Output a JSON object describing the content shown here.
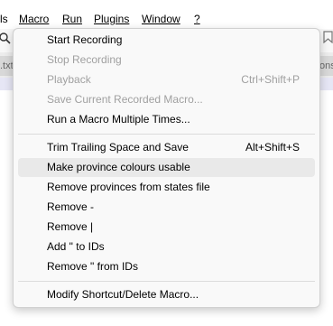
{
  "menubar": {
    "items": [
      {
        "label": "ls"
      },
      {
        "label": "Macro"
      },
      {
        "label": "Run"
      },
      {
        "label": "Plugins"
      },
      {
        "label": "Window"
      },
      {
        "label": "?"
      }
    ]
  },
  "tabs": {
    "left_fragment": ".txt",
    "right_fragment": "ons"
  },
  "macro_menu": {
    "items": [
      {
        "label": "Start Recording",
        "shortcut": "",
        "enabled": true
      },
      {
        "label": "Stop Recording",
        "shortcut": "",
        "enabled": false
      },
      {
        "label": "Playback",
        "shortcut": "Ctrl+Shift+P",
        "enabled": false
      },
      {
        "label": "Save Current Recorded Macro...",
        "shortcut": "",
        "enabled": false
      },
      {
        "label": "Run a Macro Multiple Times...",
        "shortcut": "",
        "enabled": true
      },
      {
        "label": "Trim Trailing Space and Save",
        "shortcut": "Alt+Shift+S",
        "enabled": true
      },
      {
        "label": "Make province colours usable",
        "shortcut": "",
        "enabled": true,
        "highlighted": true
      },
      {
        "label": "Remove provinces from states file",
        "shortcut": "",
        "enabled": true
      },
      {
        "label": "Remove -",
        "shortcut": "",
        "enabled": true
      },
      {
        "label": "Remove |",
        "shortcut": "",
        "enabled": true
      },
      {
        "label": "Add \" to IDs",
        "shortcut": "",
        "enabled": true
      },
      {
        "label": "Remove \" from IDs",
        "shortcut": "",
        "enabled": true
      },
      {
        "label": "Modify Shortcut/Delete Macro...",
        "shortcut": "",
        "enabled": true
      }
    ]
  },
  "icons": {
    "toolbar_left": "search-icon",
    "toolbar_right": "bookmark-icon"
  }
}
